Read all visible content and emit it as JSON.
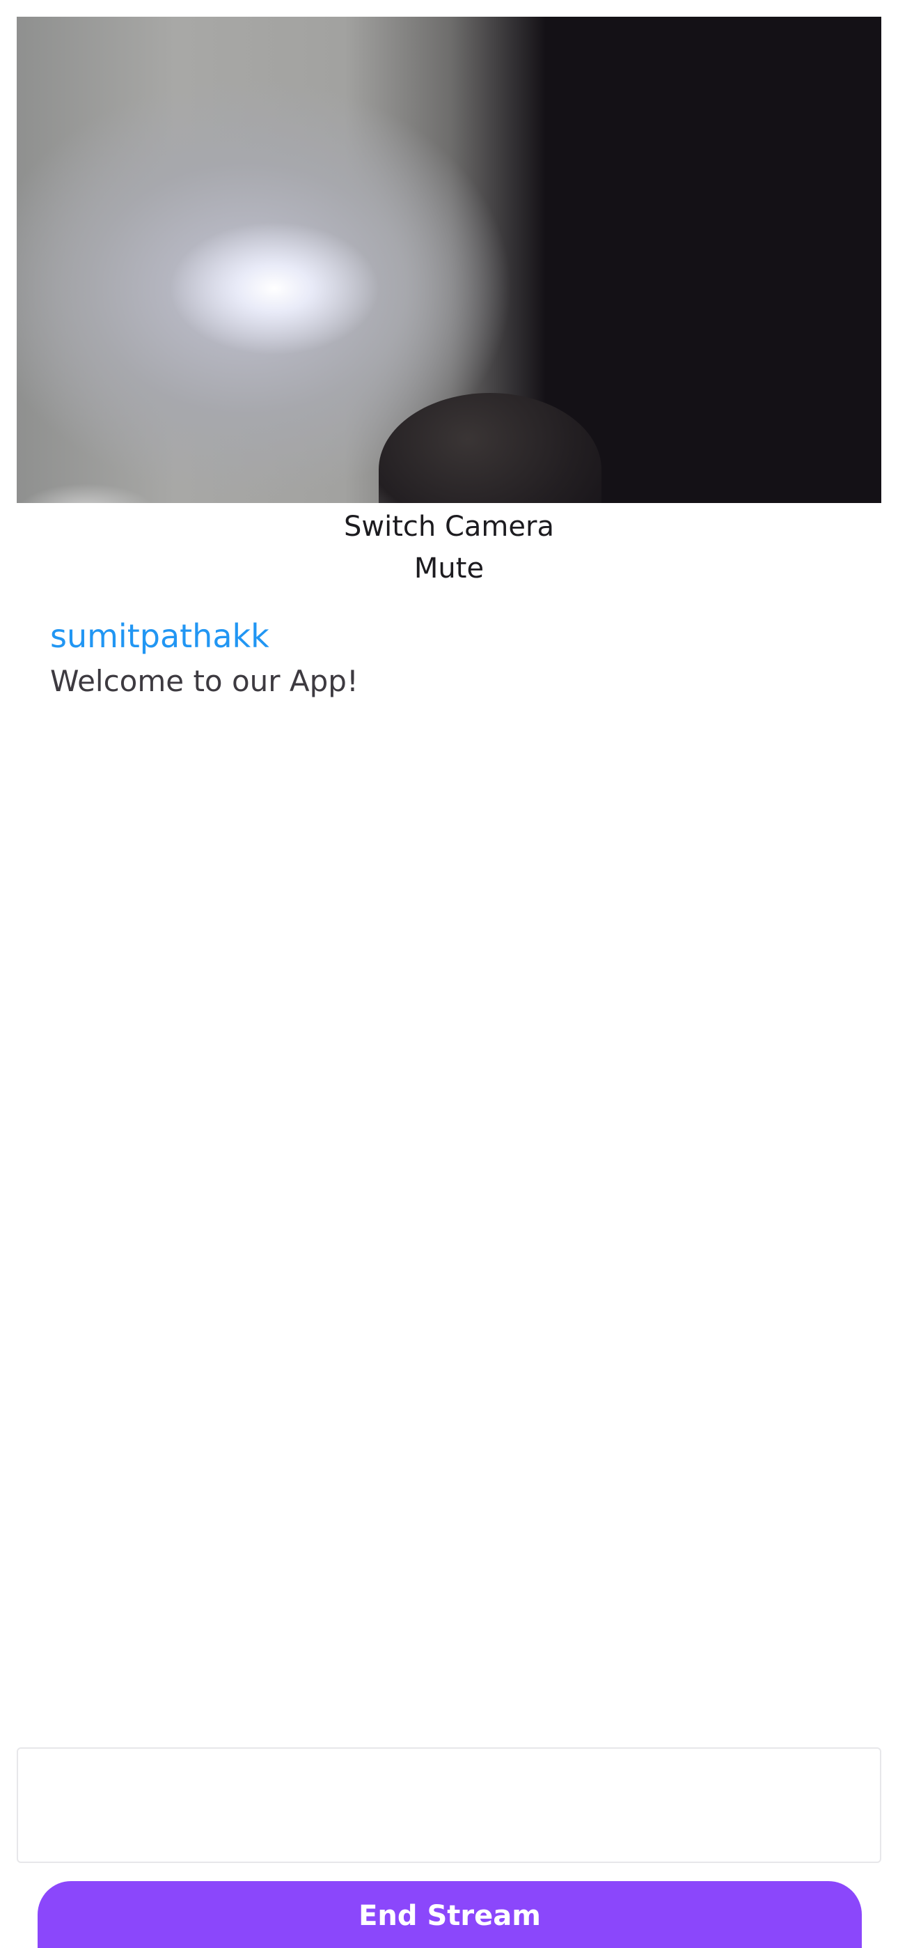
{
  "controls": {
    "switch_camera_label": "Switch Camera",
    "mute_label": "Mute"
  },
  "chat": {
    "messages": [
      {
        "username": "sumitpathakk",
        "text": "Welcome to our App!"
      }
    ],
    "input_value": ""
  },
  "footer": {
    "end_stream_label": "End Stream"
  },
  "colors": {
    "username": "#2196f3",
    "accent": "#8b47fb"
  }
}
